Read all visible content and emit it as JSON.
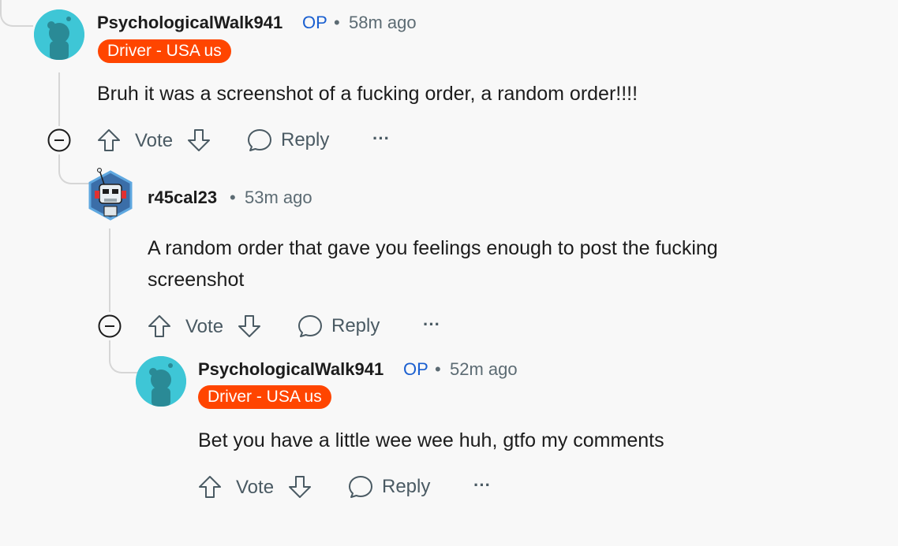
{
  "comments": [
    {
      "username": "PsychologicalWalk941",
      "op": "OP",
      "time": "58m ago",
      "flair": "Driver - USA us",
      "body": "Bruh it was a screenshot of a fucking order, a random order!!!!",
      "vote": "Vote",
      "reply": "Reply",
      "more": "···"
    },
    {
      "username": "r45cal23",
      "time": "53m ago",
      "body": "A random order that gave you feelings enough to post the fucking screenshot",
      "vote": "Vote",
      "reply": "Reply",
      "more": "···"
    },
    {
      "username": "PsychologicalWalk941",
      "op": "OP",
      "time": "52m ago",
      "flair": "Driver - USA us",
      "body": "Bet you have a little wee wee huh, gtfo my comments",
      "vote": "Vote",
      "reply": "Reply",
      "more": "···"
    }
  ],
  "separator": "•",
  "colors": {
    "flair": "#ff4500",
    "op": "#1a5fd0",
    "avatar_bg": "#3ec6d6"
  }
}
